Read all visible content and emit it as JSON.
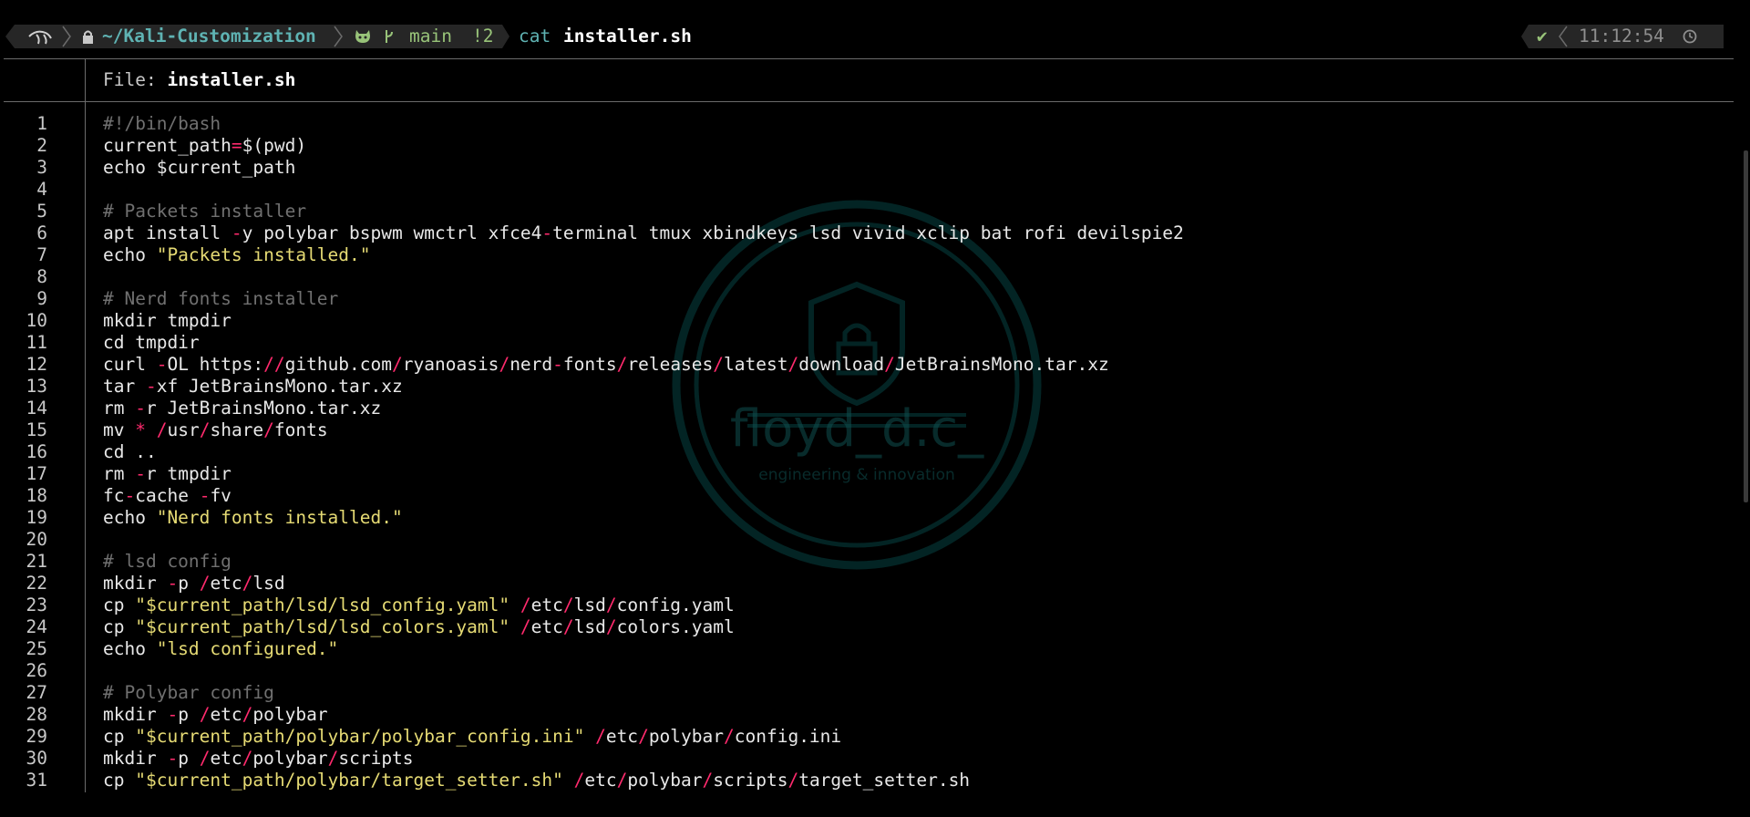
{
  "prompt": {
    "path": "~/Kali-Customization",
    "branch": "main",
    "git_status": "!2",
    "command": "cat",
    "argument": "installer.sh",
    "status_check": "✔",
    "time": "11:12:54"
  },
  "viewer": {
    "file_label": "File: ",
    "file_name": "installer.sh"
  },
  "watermark": {
    "title": "floyd_d.c_",
    "subtitle": "engineering & innovation"
  },
  "code_lines": [
    {
      "n": "1",
      "t": [
        [
          "c",
          "#!/bin/bash"
        ]
      ]
    },
    {
      "n": "2",
      "t": [
        [
          "p",
          "current_path"
        ],
        [
          "op",
          "="
        ],
        [
          "p",
          "$(pwd)"
        ]
      ]
    },
    {
      "n": "3",
      "t": [
        [
          "p",
          "echo $current_path"
        ]
      ]
    },
    {
      "n": "4",
      "t": []
    },
    {
      "n": "5",
      "t": [
        [
          "c",
          "# Packets installer"
        ]
      ]
    },
    {
      "n": "6",
      "t": [
        [
          "p",
          "apt install "
        ],
        [
          "op",
          "-"
        ],
        [
          "p",
          "y polybar bspwm wmctrl xfce4"
        ],
        [
          "op",
          "-"
        ],
        [
          "p",
          "terminal tmux xbindkeys lsd vivid xclip bat rofi devilspie2"
        ]
      ]
    },
    {
      "n": "7",
      "t": [
        [
          "p",
          "echo "
        ],
        [
          "s",
          "\"Packets installed.\""
        ]
      ]
    },
    {
      "n": "8",
      "t": []
    },
    {
      "n": "9",
      "t": [
        [
          "c",
          "# Nerd fonts installer"
        ]
      ]
    },
    {
      "n": "10",
      "t": [
        [
          "p",
          "mkdir tmpdir"
        ]
      ]
    },
    {
      "n": "11",
      "t": [
        [
          "p",
          "cd tmpdir"
        ]
      ]
    },
    {
      "n": "12",
      "t": [
        [
          "p",
          "curl "
        ],
        [
          "op",
          "-"
        ],
        [
          "p",
          "OL https:"
        ],
        [
          "op",
          "//"
        ],
        [
          "p",
          "github.com"
        ],
        [
          "op",
          "/"
        ],
        [
          "p",
          "ryanoasis"
        ],
        [
          "op",
          "/"
        ],
        [
          "p",
          "nerd"
        ],
        [
          "op",
          "-"
        ],
        [
          "p",
          "fonts"
        ],
        [
          "op",
          "/"
        ],
        [
          "p",
          "releases"
        ],
        [
          "op",
          "/"
        ],
        [
          "p",
          "latest"
        ],
        [
          "op",
          "/"
        ],
        [
          "p",
          "download"
        ],
        [
          "op",
          "/"
        ],
        [
          "p",
          "JetBrainsMono.tar.xz"
        ]
      ]
    },
    {
      "n": "13",
      "t": [
        [
          "p",
          "tar "
        ],
        [
          "op",
          "-"
        ],
        [
          "p",
          "xf JetBrainsMono.tar.xz"
        ]
      ]
    },
    {
      "n": "14",
      "t": [
        [
          "p",
          "rm "
        ],
        [
          "op",
          "-"
        ],
        [
          "p",
          "r JetBrainsMono.tar.xz"
        ]
      ]
    },
    {
      "n": "15",
      "t": [
        [
          "p",
          "mv "
        ],
        [
          "op",
          "*"
        ],
        [
          "p",
          " "
        ],
        [
          "op",
          "/"
        ],
        [
          "p",
          "usr"
        ],
        [
          "op",
          "/"
        ],
        [
          "p",
          "share"
        ],
        [
          "op",
          "/"
        ],
        [
          "p",
          "fonts"
        ]
      ]
    },
    {
      "n": "16",
      "t": [
        [
          "p",
          "cd .."
        ]
      ]
    },
    {
      "n": "17",
      "t": [
        [
          "p",
          "rm "
        ],
        [
          "op",
          "-"
        ],
        [
          "p",
          "r tmpdir"
        ]
      ]
    },
    {
      "n": "18",
      "t": [
        [
          "p",
          "fc"
        ],
        [
          "op",
          "-"
        ],
        [
          "p",
          "cache "
        ],
        [
          "op",
          "-"
        ],
        [
          "p",
          "fv"
        ]
      ]
    },
    {
      "n": "19",
      "t": [
        [
          "p",
          "echo "
        ],
        [
          "s",
          "\"Nerd fonts installed.\""
        ]
      ]
    },
    {
      "n": "20",
      "t": []
    },
    {
      "n": "21",
      "t": [
        [
          "c",
          "# lsd config"
        ]
      ]
    },
    {
      "n": "22",
      "t": [
        [
          "p",
          "mkdir "
        ],
        [
          "op",
          "-"
        ],
        [
          "p",
          "p "
        ],
        [
          "op",
          "/"
        ],
        [
          "p",
          "etc"
        ],
        [
          "op",
          "/"
        ],
        [
          "p",
          "lsd"
        ]
      ]
    },
    {
      "n": "23",
      "t": [
        [
          "p",
          "cp "
        ],
        [
          "s",
          "\"$current_path/lsd/lsd_config.yaml\""
        ],
        [
          "p",
          " "
        ],
        [
          "op",
          "/"
        ],
        [
          "p",
          "etc"
        ],
        [
          "op",
          "/"
        ],
        [
          "p",
          "lsd"
        ],
        [
          "op",
          "/"
        ],
        [
          "p",
          "config.yaml"
        ]
      ]
    },
    {
      "n": "24",
      "t": [
        [
          "p",
          "cp "
        ],
        [
          "s",
          "\"$current_path/lsd/lsd_colors.yaml\""
        ],
        [
          "p",
          " "
        ],
        [
          "op",
          "/"
        ],
        [
          "p",
          "etc"
        ],
        [
          "op",
          "/"
        ],
        [
          "p",
          "lsd"
        ],
        [
          "op",
          "/"
        ],
        [
          "p",
          "colors.yaml"
        ]
      ]
    },
    {
      "n": "25",
      "t": [
        [
          "p",
          "echo "
        ],
        [
          "s",
          "\"lsd configured.\""
        ]
      ]
    },
    {
      "n": "26",
      "t": []
    },
    {
      "n": "27",
      "t": [
        [
          "c",
          "# Polybar config"
        ]
      ]
    },
    {
      "n": "28",
      "t": [
        [
          "p",
          "mkdir "
        ],
        [
          "op",
          "-"
        ],
        [
          "p",
          "p "
        ],
        [
          "op",
          "/"
        ],
        [
          "p",
          "etc"
        ],
        [
          "op",
          "/"
        ],
        [
          "p",
          "polybar"
        ]
      ]
    },
    {
      "n": "29",
      "t": [
        [
          "p",
          "cp "
        ],
        [
          "s",
          "\"$current_path/polybar/polybar_config.ini\""
        ],
        [
          "p",
          " "
        ],
        [
          "op",
          "/"
        ],
        [
          "p",
          "etc"
        ],
        [
          "op",
          "/"
        ],
        [
          "p",
          "polybar"
        ],
        [
          "op",
          "/"
        ],
        [
          "p",
          "config.ini"
        ]
      ]
    },
    {
      "n": "30",
      "t": [
        [
          "p",
          "mkdir "
        ],
        [
          "op",
          "-"
        ],
        [
          "p",
          "p "
        ],
        [
          "op",
          "/"
        ],
        [
          "p",
          "etc"
        ],
        [
          "op",
          "/"
        ],
        [
          "p",
          "polybar"
        ],
        [
          "op",
          "/"
        ],
        [
          "p",
          "scripts"
        ]
      ]
    },
    {
      "n": "31",
      "t": [
        [
          "p",
          "cp "
        ],
        [
          "s",
          "\"$current_path/polybar/target_setter.sh\""
        ],
        [
          "p",
          " "
        ],
        [
          "op",
          "/"
        ],
        [
          "p",
          "etc"
        ],
        [
          "op",
          "/"
        ],
        [
          "p",
          "polybar"
        ],
        [
          "op",
          "/"
        ],
        [
          "p",
          "scripts"
        ],
        [
          "op",
          "/"
        ],
        [
          "p",
          "target_setter.sh"
        ]
      ]
    }
  ],
  "colors": {
    "background": "#000000",
    "path": "#5fb3b3",
    "git": "#98c379",
    "operator": "#ff2a6d",
    "string": "#e6db74",
    "comment": "#707070"
  }
}
